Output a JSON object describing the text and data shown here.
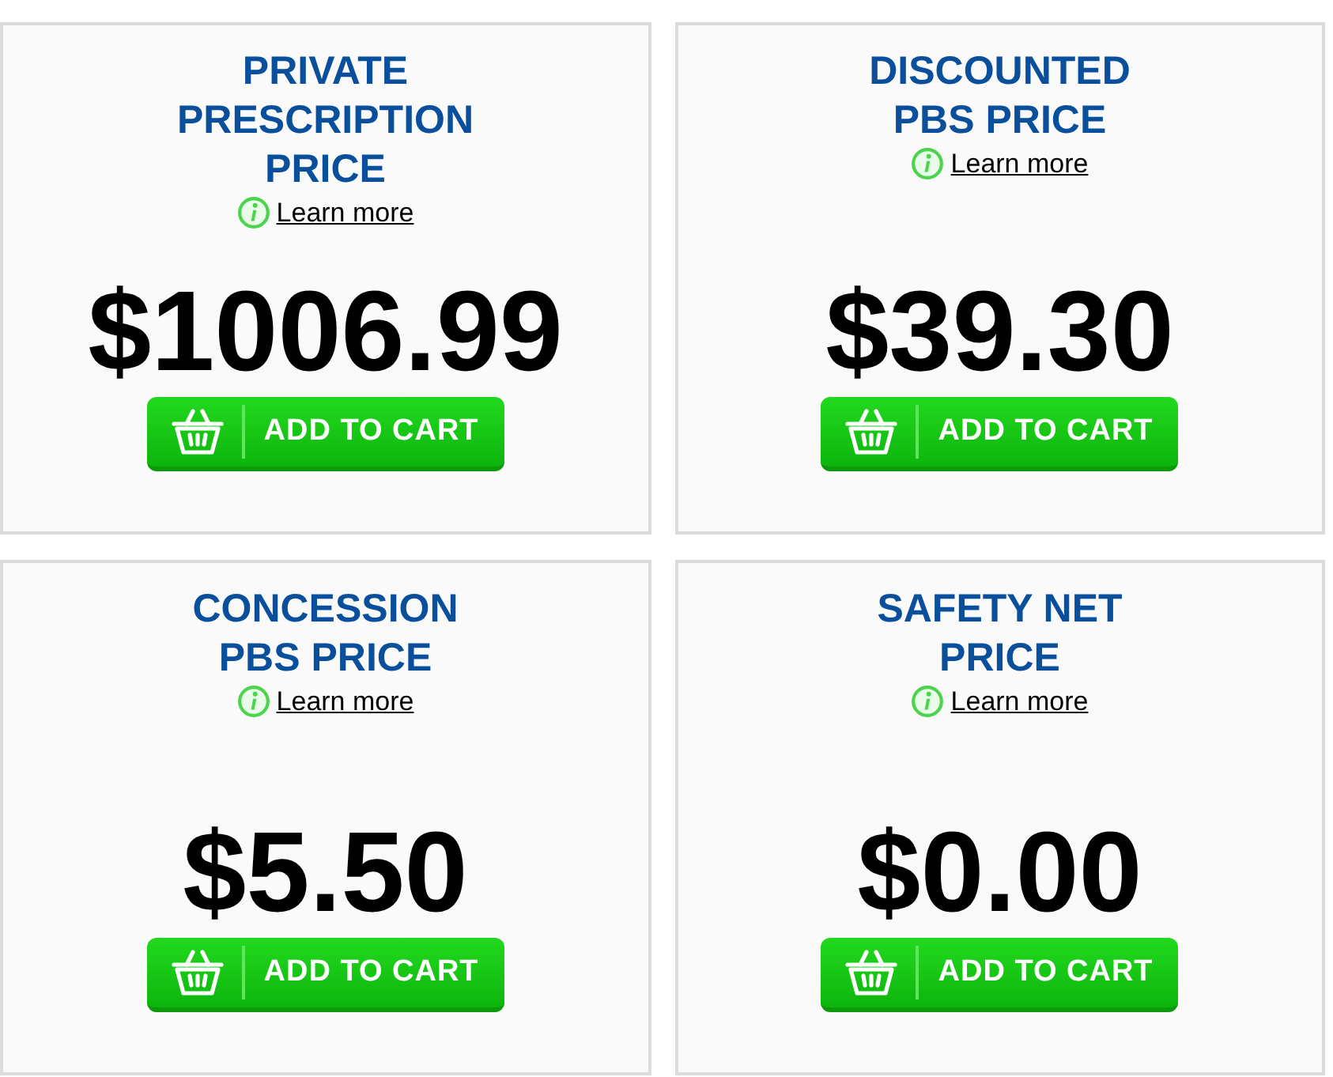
{
  "cards": [
    {
      "title_lines": [
        "PRIVATE",
        "PRESCRIPTION",
        "PRICE"
      ],
      "learn_more": "Learn more",
      "price": "$1006.99",
      "button": "ADD TO CART"
    },
    {
      "title_lines": [
        "DISCOUNTED",
        "PBS PRICE"
      ],
      "learn_more": "Learn more",
      "price": "$39.30",
      "button": "ADD TO CART"
    },
    {
      "title_lines": [
        "CONCESSION",
        "PBS PRICE"
      ],
      "learn_more": "Learn more",
      "price": "$5.50",
      "button": "ADD TO CART"
    },
    {
      "title_lines": [
        "SAFETY NET",
        "PRICE"
      ],
      "learn_more": "Learn more",
      "price": "$0.00",
      "button": "ADD TO CART"
    }
  ]
}
